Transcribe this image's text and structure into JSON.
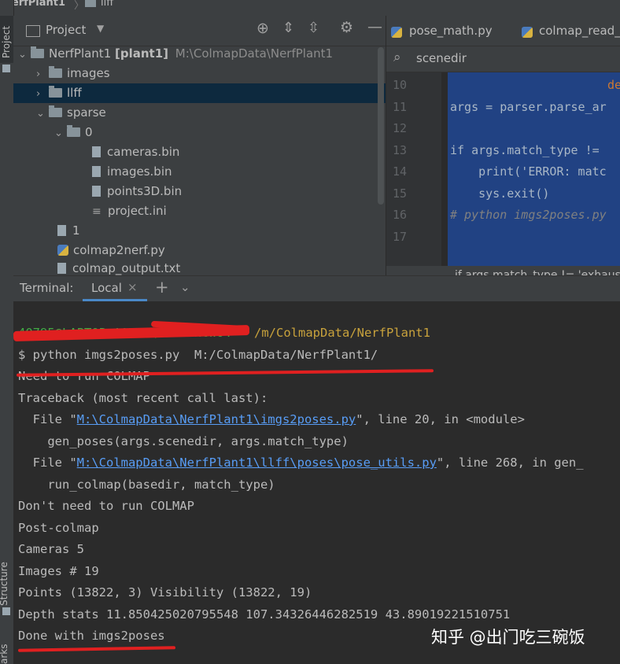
{
  "breadcrumb": {
    "project": "NerfPlant1",
    "folder": "llff"
  },
  "strip": {
    "project": "Project",
    "structure": "Structure",
    "bookmarks": "arks"
  },
  "project_panel": {
    "title": "Project",
    "tree": [
      {
        "label": "NerfPlant1",
        "module": "[plant1]",
        "path": "M:\\ColmapData\\NerfPlant1",
        "type": "folder",
        "expanded": true
      },
      {
        "label": "images",
        "type": "folder",
        "expanded": false
      },
      {
        "label": "llff",
        "type": "folder",
        "expanded": false,
        "selected": true
      },
      {
        "label": "sparse",
        "type": "folder",
        "expanded": true
      },
      {
        "label": "0",
        "type": "folder",
        "expanded": true
      },
      {
        "label": "cameras.bin",
        "type": "file-unknown"
      },
      {
        "label": "images.bin",
        "type": "file-unknown"
      },
      {
        "label": "points3D.bin",
        "type": "file-unknown"
      },
      {
        "label": "project.ini",
        "type": "file-text"
      },
      {
        "label": "1",
        "type": "file"
      },
      {
        "label": "colmap2nerf.py",
        "type": "python"
      },
      {
        "label": "colmap_output.txt",
        "type": "text"
      }
    ]
  },
  "editor": {
    "tabs": [
      "pose_math.py",
      "colmap_read_m"
    ],
    "search_value": "scenedir",
    "lines": [
      {
        "n": "10",
        "text": "de"
      },
      {
        "n": "11",
        "text": "args = parser.parse_ar"
      },
      {
        "n": "12",
        "text": ""
      },
      {
        "n": "13",
        "text": "if args.match_type != "
      },
      {
        "n": "14",
        "text": "    print('ERROR: matc"
      },
      {
        "n": "15",
        "text": "    sys.exit()"
      },
      {
        "n": "16",
        "text": "# python imgs2poses.py"
      },
      {
        "n": "17",
        "text": ""
      }
    ],
    "breadcrumb_tip": "if args.match_type != 'exhaus"
  },
  "terminal": {
    "header_label": "Terminal:",
    "tab_label": "Local",
    "prompt_path": "/m/ColmapData/NerfPlant1",
    "prompt_user": "40795@LAPTOP-AA7S5QKJ MINGW64",
    "command": "$ python imgs2poses.py  M:/ColmapData/NerfPlant1/",
    "lines": [
      "Need to run COLMAP",
      "Traceback (most recent call last):"
    ],
    "file1_prefix": "  File \"",
    "file1_link": "M:\\ColmapData\\NerfPlant1\\imgs2poses.py",
    "file1_suffix": "\", line 20, in <module>",
    "call1": "    gen_poses(args.scenedir, args.match_type)",
    "file2_prefix": "  File \"",
    "file2_link": "M:\\ColmapData\\NerfPlant1\\llff\\poses\\pose_utils.py",
    "file2_suffix": "\", line 268, in gen_",
    "call2": "    run_colmap(basedir, match_type)",
    "output": [
      "Don't need to run COLMAP",
      "Post-colmap",
      "Cameras 5",
      "Images # 19",
      "Points (13822, 3) Visibility (13822, 19)",
      "Depth stats 11.850425020795548 107.34326446282519 43.89019221510751",
      "Done with imgs2poses"
    ]
  },
  "watermark": "知乎 @出门吃三碗饭",
  "colors": {
    "selection_bg": "#0d293e",
    "code_selection": "#214283",
    "link": "#589df6",
    "annotation": "#e02020"
  }
}
